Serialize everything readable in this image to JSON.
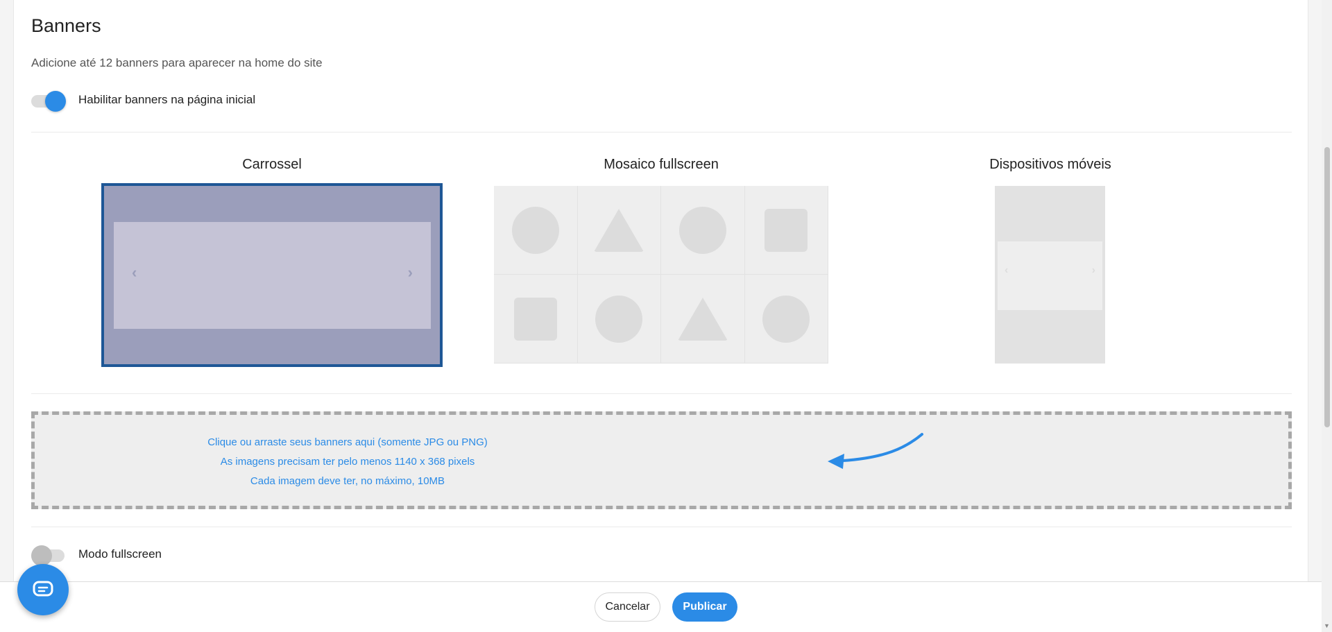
{
  "section": {
    "title": "Banners",
    "subtitle": "Adicione até 12 banners para aparecer na home do site",
    "enable_toggle": {
      "label": "Habilitar banners na página inicial",
      "state": "on"
    }
  },
  "layouts": [
    {
      "title": "Carrossel",
      "selected": true
    },
    {
      "title": "Mosaico fullscreen",
      "selected": false
    },
    {
      "title": "Dispositivos móveis",
      "selected": false
    }
  ],
  "dropzone": {
    "line1": "Clique ou arraste seus banners aqui (somente JPG ou PNG)",
    "line2": "As imagens precisam ter pelo menos 1140 x 368 pixels",
    "line3": "Cada imagem deve ter, no máximo,  10MB"
  },
  "fullscreen_toggle": {
    "label": "Modo fullscreen",
    "state": "off"
  },
  "footer": {
    "cancel_label": "Cancelar",
    "publish_label": "Publicar"
  },
  "icons": {
    "carousel_prev": "‹",
    "carousel_next": "›",
    "mobile_prev": "‹",
    "mobile_next": "›"
  },
  "colors": {
    "accent": "#2b8be6",
    "selected_border": "#1e5796"
  }
}
